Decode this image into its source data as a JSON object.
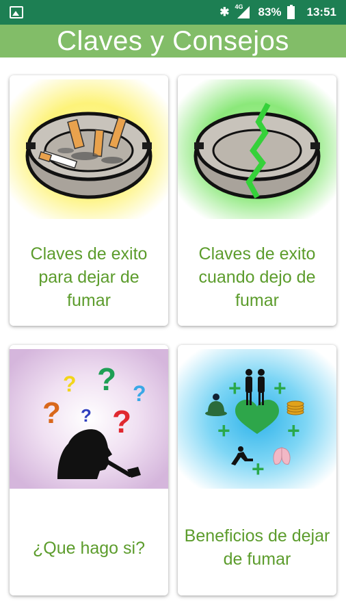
{
  "status_bar": {
    "network": "4G",
    "battery": "83%",
    "time": "13:51"
  },
  "header": {
    "title": "Claves y Consejos"
  },
  "cards": [
    {
      "label": "Claves de exito para dejar de fumar",
      "image": "ashtray-icon"
    },
    {
      "label": "Claves de exito cuando dejo de fumar",
      "image": "broken-ashtray-icon"
    },
    {
      "label": "¿Que hago si?",
      "image": "question-head-icon"
    },
    {
      "label": "Beneficios de dejar de fumar",
      "image": "benefits-icon"
    }
  ],
  "colors": {
    "status_bar": "#1d7f53",
    "title_bar": "#82bd68",
    "label_text": "#5c9c2c"
  }
}
